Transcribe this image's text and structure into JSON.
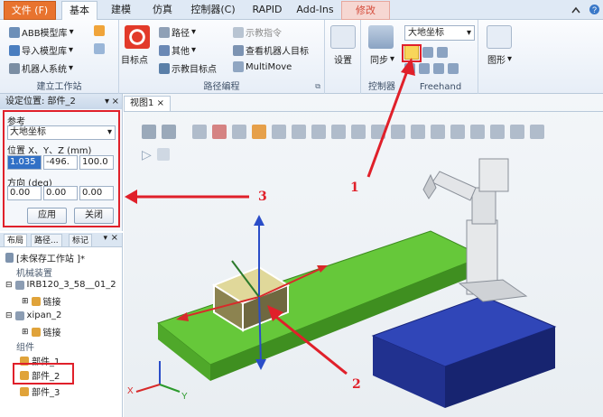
{
  "tabs": [
    "文件 (F)",
    "基本",
    "建模",
    "仿真",
    "控制器(C)",
    "RAPID",
    "Add-Ins",
    "修改"
  ],
  "ribbon": {
    "abb_library": "ABB模型库",
    "import_library": "导入模型库",
    "robot_system": "机器人系统",
    "group_build": "建立工作站",
    "target_point": "目标点",
    "path": "路径",
    "other": "其他",
    "teach_target": "示教目标点",
    "teach_instruction": "示教指令",
    "view_robot_target": "查看机器人目标",
    "multimove": "MultiMove",
    "group_path": "路径编程",
    "settings": "设置",
    "sync": "同步",
    "group_controller": "控制器",
    "coord_select": "大地坐标",
    "group_freehand": "Freehand",
    "graphics": "图形"
  },
  "set_position": {
    "title": "设定位置: 部件_2",
    "ref_label": "参考",
    "ref_value": "大地坐标",
    "pos_label": "位置 X、Y、Z (mm)",
    "pos_x": "1.035",
    "pos_y": "-496.",
    "pos_z": "100.0",
    "dir_label": "方向 (deg)",
    "dir_x": "0.00",
    "dir_y": "0.00",
    "dir_z": "0.00",
    "apply": "应用",
    "close": "关闭"
  },
  "layout": {
    "tabs": [
      "布局",
      "路径...",
      "标记"
    ],
    "station": "[未保存工作站 ]*",
    "mechanisms": "机械装置",
    "robot": "IRB120_3_58__01_2",
    "link1": "链接",
    "xipan": "xipan_2",
    "link2": "链接",
    "components": "组件",
    "part1": "部件_1",
    "part2": "部件_2",
    "part3": "部件_3"
  },
  "viewport": {
    "tab": "视图1"
  },
  "annotations": [
    "1",
    "2",
    "3"
  ],
  "axes": {
    "x": "X",
    "y": "Y"
  },
  "colors": {
    "accent_red": "#e0202a",
    "file_tab": "#e8732e",
    "table_green": "#66c83a",
    "box_blue": "#21318f"
  }
}
